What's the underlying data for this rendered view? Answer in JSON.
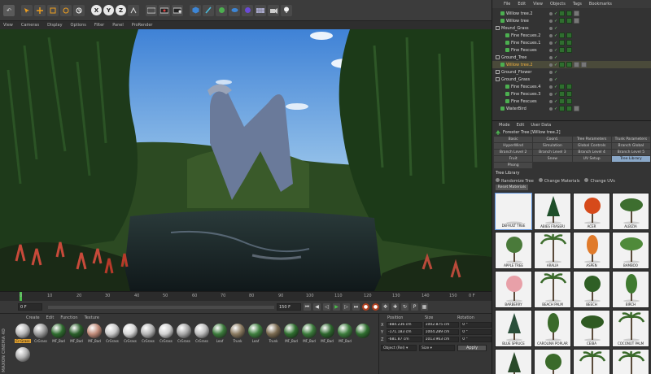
{
  "viewport_menu": [
    "View",
    "Cameras",
    "Display",
    "Options",
    "Filter",
    "Panel",
    "ProRender"
  ],
  "toolbar": {
    "undo": "↶",
    "tool_icons": [
      "select-arrow-icon",
      "move-icon",
      "scale-icon",
      "rotate-icon",
      "recent-tool-icon"
    ],
    "axes": [
      "X",
      "Y",
      "Z"
    ]
  },
  "timeline": {
    "ticks": [
      "0",
      "10",
      "20",
      "30",
      "40",
      "50",
      "60",
      "70",
      "80",
      "90",
      "100",
      "110",
      "120",
      "130",
      "140",
      "150"
    ],
    "end_label": "0 F",
    "playhead": 0.04
  },
  "transport": {
    "start_frame": "0 F",
    "end_frame": "150 F"
  },
  "materials": {
    "menu": [
      "Create",
      "Edit",
      "Function",
      "Texture"
    ],
    "brand": "MAXON CINEMA 4D",
    "items": [
      {
        "name": "Cr-Grass",
        "color": "#b8b8b8",
        "selected": true
      },
      {
        "name": "CrGrass",
        "color": "#9a9a9a"
      },
      {
        "name": "MF_Bad",
        "color": "#2e6b2e"
      },
      {
        "name": "MF_Bad",
        "color": "#2a5e2a"
      },
      {
        "name": "MF_Bad",
        "color": "#c08a78"
      },
      {
        "name": "CrGrass",
        "color": "#c9c9c9"
      },
      {
        "name": "CrGrass",
        "color": "#d6d6d6"
      },
      {
        "name": "CrGrass",
        "color": "#b5b5b5"
      },
      {
        "name": "CrGrass",
        "color": "#cfcfcf"
      },
      {
        "name": "CrGrass",
        "color": "#a8a8a8"
      },
      {
        "name": "CrGrass",
        "color": "#bcbcbc"
      },
      {
        "name": "Leaf",
        "color": "#3b7a3b"
      },
      {
        "name": "Trunk",
        "color": "#8a7a60"
      },
      {
        "name": "Leaf",
        "color": "#3f7f3f"
      },
      {
        "name": "Trunk",
        "color": "#7a6a50"
      },
      {
        "name": "MF_Bad",
        "color": "#2f6f2f"
      },
      {
        "name": "MF_Bad",
        "color": "#3a7a3a"
      },
      {
        "name": "MF_Bad",
        "color": "#2c662c"
      },
      {
        "name": "MF_Bad",
        "color": "#3d7d3d"
      },
      {
        "name": "",
        "color": "#2f6f2f"
      },
      {
        "name": "",
        "color": "#b0b0b0"
      }
    ]
  },
  "coords": {
    "headers": [
      "Position",
      "Size",
      "Rotation"
    ],
    "rows": [
      {
        "axis": "X",
        "pos": "-884.236 cm",
        "size": "1002.875 cm",
        "rot": "0 °"
      },
      {
        "axis": "Y",
        "pos": "-171.183 cm",
        "size": "1004.289 cm",
        "rot": "0 °"
      },
      {
        "axis": "Z",
        "pos": "-681.87 cm",
        "size": "1013.963 cm",
        "rot": "0 °"
      }
    ],
    "mode": "Object (Rel) ▾",
    "size_mode": "Size ▾",
    "apply": "Apply"
  },
  "object_manager": {
    "menu": [
      "File",
      "Edit",
      "View",
      "Objects",
      "Tags",
      "Bookmarks"
    ],
    "rows": [
      {
        "name": "Willow tree.2",
        "indent": 1,
        "tags": 3,
        "hl": false
      },
      {
        "name": "Willow tree",
        "indent": 1,
        "tags": 3,
        "hl": false
      },
      {
        "name": "Mound_Grass",
        "indent": 0,
        "tags": 0,
        "hl": false
      },
      {
        "name": "Fine Fescues.2",
        "indent": 2,
        "tags": 2,
        "hl": false
      },
      {
        "name": "Fine Fescues.1",
        "indent": 2,
        "tags": 2,
        "hl": false
      },
      {
        "name": "Fine Fescues",
        "indent": 2,
        "tags": 2,
        "hl": false
      },
      {
        "name": "Ground_Tree",
        "indent": 0,
        "tags": 0,
        "hl": false
      },
      {
        "name": "Willow tree.2",
        "indent": 1,
        "tags": 4,
        "hl": true
      },
      {
        "name": "Ground_Flower",
        "indent": 0,
        "tags": 0,
        "hl": false
      },
      {
        "name": "Ground_Grass",
        "indent": 0,
        "tags": 0,
        "hl": false
      },
      {
        "name": "Fine Fescues.4",
        "indent": 2,
        "tags": 2,
        "hl": false
      },
      {
        "name": "Fine Fescues.3",
        "indent": 2,
        "tags": 2,
        "hl": false
      },
      {
        "name": "Fine Fescues",
        "indent": 2,
        "tags": 2,
        "hl": false
      },
      {
        "name": "WaterBird",
        "indent": 1,
        "tags": 3,
        "hl": false
      }
    ]
  },
  "attributes": {
    "menu": [
      "Mode",
      "Edit",
      "User Data"
    ],
    "title": "Forester Tree [Willow tree.2]",
    "tabs": [
      "Basic",
      "Coord.",
      "Tree Parameters",
      "Trunk Parameters",
      "HyperWind",
      "Simulation",
      "Global Controls",
      "Branch Global",
      "Branch Level 2",
      "Branch Level 3",
      "Branch Level 4",
      "Branch Level 5",
      "Fruit",
      "Snow",
      "UV Setup",
      "Tree Library",
      "Phong"
    ],
    "active_tab": "Tree Library",
    "section": "Tree Library",
    "options": [
      "Randomize Tree",
      "Change Materials",
      "Change UVs"
    ],
    "reset": "Reset Materials",
    "library": [
      {
        "name": "DEFAULT TREE",
        "kind": "plain",
        "color": "#444444"
      },
      {
        "name": "ABIES FRASERI",
        "kind": "conifer",
        "color": "#1f4f2a"
      },
      {
        "name": "ACER",
        "kind": "round",
        "color": "#d64a1a"
      },
      {
        "name": "ALBIZIA",
        "kind": "flat",
        "color": "#3d6e2f"
      },
      {
        "name": "APPLE TREE",
        "kind": "round",
        "color": "#4a7a3a"
      },
      {
        "name": "ARALIA",
        "kind": "palm",
        "color": "#3f6f2f"
      },
      {
        "name": "ASPEN",
        "kind": "tall",
        "color": "#e07a2a"
      },
      {
        "name": "BAMBOO",
        "kind": "flat",
        "color": "#4f8a3a"
      },
      {
        "name": "BARBERRY",
        "kind": "round",
        "color": "#e8a0a8"
      },
      {
        "name": "BEACH PALM",
        "kind": "palm",
        "color": "#3a6a2a"
      },
      {
        "name": "BEECH",
        "kind": "round",
        "color": "#2f5f25"
      },
      {
        "name": "BIRCH",
        "kind": "tall",
        "color": "#3f7a30"
      },
      {
        "name": "BLUE SPRUCE",
        "kind": "conifer",
        "color": "#2a4f3a"
      },
      {
        "name": "CAROLINA POPLAR",
        "kind": "tall",
        "color": "#3a6a2a"
      },
      {
        "name": "CEIBA",
        "kind": "flat",
        "color": "#2f5a22"
      },
      {
        "name": "COCONUT PALM",
        "kind": "palm",
        "color": "#3a6a2a"
      },
      {
        "name": "",
        "kind": "conifer",
        "color": "#2a4a2a"
      },
      {
        "name": "",
        "kind": "round",
        "color": "#3a6a2a"
      },
      {
        "name": "",
        "kind": "palm",
        "color": "#3a6a2a"
      },
      {
        "name": "",
        "kind": "palm",
        "color": "#3a6a2a"
      }
    ]
  }
}
